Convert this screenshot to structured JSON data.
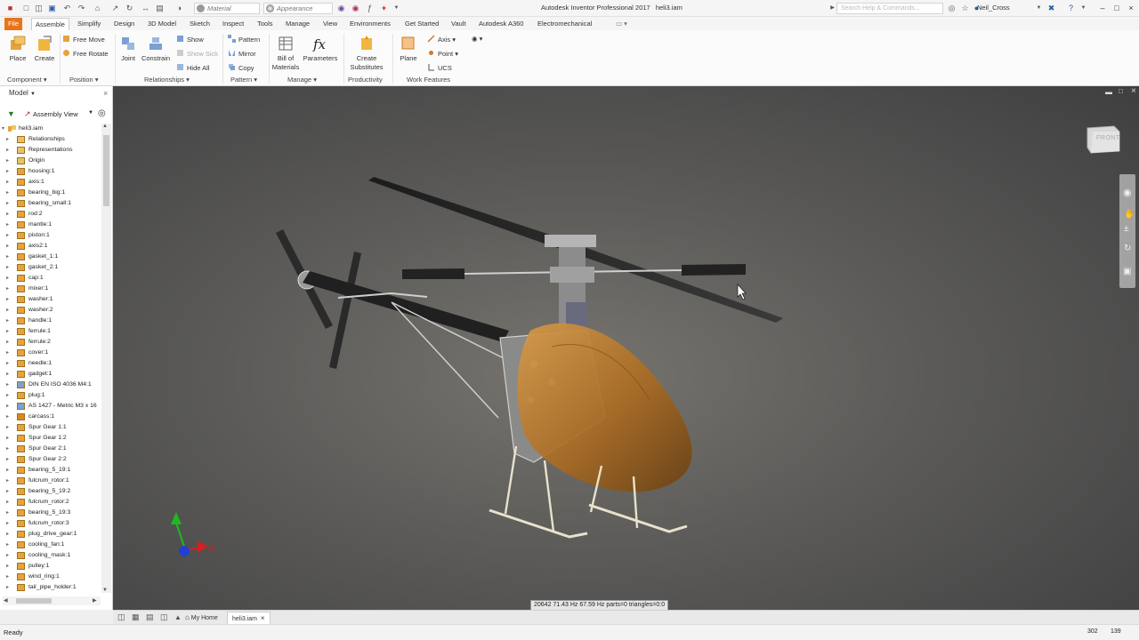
{
  "title_bar": {
    "app_title": "Autodesk Inventor Professional 2017",
    "document_name": "heli3.iam",
    "material_combo": "Material",
    "appearance_combo": "Appearance",
    "search_placeholder": "Search Help & Commands...",
    "user_name": "Neil_Cross"
  },
  "ribbon_tabs": [
    "File",
    "Assemble",
    "Simplify",
    "Design",
    "3D Model",
    "Sketch",
    "Tools",
    "Inspect",
    "Manage",
    "View",
    "Environments",
    "Get Started",
    "Vault",
    "Autodesk A360",
    "Electromechanical"
  ],
  "active_tab": "Assemble",
  "ribbon": {
    "place": "Place",
    "create": "Create",
    "free_move": "Free Move",
    "free_rotate": "Free Rotate",
    "joint": "Joint",
    "constrain": "Constrain",
    "show": "Show",
    "show_sick": "Show Sick",
    "hide_all": "Hide All",
    "pattern": "Pattern",
    "mirror": "Mirror",
    "copy": "Copy",
    "bom_line1": "Bill of",
    "bom_line2": "Materials",
    "parameters": "Parameters",
    "create_subs_line1": "Create",
    "create_subs_line2": "Substitutes",
    "plane": "Plane",
    "axis": "Axis",
    "point": "Point",
    "ucs": "UCS",
    "groups": {
      "component": "Component",
      "position": "Position",
      "relationships": "Relationships",
      "pattern": "Pattern",
      "manage": "Manage",
      "productivity": "Productivity",
      "work_features": "Work Features"
    }
  },
  "browser": {
    "title": "Model",
    "view": "Assembly View",
    "root": "heli3.iam",
    "nodes": [
      {
        "label": "Relationships",
        "kind": "folder"
      },
      {
        "label": "Representations",
        "kind": "folder"
      },
      {
        "label": "Origin",
        "kind": "folder"
      },
      {
        "label": "housing:1",
        "kind": "part"
      },
      {
        "label": "axis:1",
        "kind": "part"
      },
      {
        "label": "bearing_big:1",
        "kind": "part"
      },
      {
        "label": "bearing_small:1",
        "kind": "part"
      },
      {
        "label": "rod:2",
        "kind": "part"
      },
      {
        "label": "mantle:1",
        "kind": "part"
      },
      {
        "label": "piston:1",
        "kind": "part"
      },
      {
        "label": "axis2:1",
        "kind": "part"
      },
      {
        "label": "gasket_1:1",
        "kind": "part"
      },
      {
        "label": "gasket_2:1",
        "kind": "part"
      },
      {
        "label": "cap:1",
        "kind": "part"
      },
      {
        "label": "mixer:1",
        "kind": "part"
      },
      {
        "label": "washer:1",
        "kind": "part"
      },
      {
        "label": "washer:2",
        "kind": "part"
      },
      {
        "label": "handle:1",
        "kind": "part"
      },
      {
        "label": "ferrule:1",
        "kind": "part"
      },
      {
        "label": "ferrule:2",
        "kind": "part"
      },
      {
        "label": "cover:1",
        "kind": "part"
      },
      {
        "label": "needle:1",
        "kind": "part"
      },
      {
        "label": "gadget:1",
        "kind": "part"
      },
      {
        "label": "DIN EN ISO 4036 M4:1",
        "kind": "cc"
      },
      {
        "label": "plug:1",
        "kind": "part"
      },
      {
        "label": "AS 1427 - Metric M3 x 16",
        "kind": "cc"
      },
      {
        "label": "carcass:1",
        "kind": "asm"
      },
      {
        "label": "Spur Gear 1:1",
        "kind": "part"
      },
      {
        "label": "Spur Gear 1:2",
        "kind": "part"
      },
      {
        "label": "Spur Gear 2:1",
        "kind": "part"
      },
      {
        "label": "Spur Gear 2:2",
        "kind": "part"
      },
      {
        "label": "bearing_5_19:1",
        "kind": "part"
      },
      {
        "label": "fulcrum_rotor:1",
        "kind": "part"
      },
      {
        "label": "bearing_5_19:2",
        "kind": "part"
      },
      {
        "label": "fulcrum_rotor:2",
        "kind": "part"
      },
      {
        "label": "bearing_5_19:3",
        "kind": "part"
      },
      {
        "label": "fulcrum_rotor:3",
        "kind": "part"
      },
      {
        "label": "plug_drive_gear:1",
        "kind": "part"
      },
      {
        "label": "cooling_fan:1",
        "kind": "part"
      },
      {
        "label": "cooling_mask:1",
        "kind": "part"
      },
      {
        "label": "pulley:1",
        "kind": "part"
      },
      {
        "label": "wind_ring:1",
        "kind": "part"
      },
      {
        "label": "tail_pipe_holder:1",
        "kind": "part"
      }
    ]
  },
  "viewport": {
    "viewcube_face": "FRONT",
    "triad_x_label": "X",
    "perf_text": "20642 71.43 Hz 67.59 Hz parts=0 triangles=0:0"
  },
  "doc_tabs": {
    "home": "My Home",
    "doc": "heli3.iam"
  },
  "status": {
    "text": "Ready",
    "count1": "302",
    "count2": "139"
  },
  "colors": {
    "file_tab": "#e8741a",
    "canopy": "#b87a2c",
    "axis_x": "#d42020",
    "axis_y": "#1fb81f",
    "axis_z": "#2040d0"
  }
}
